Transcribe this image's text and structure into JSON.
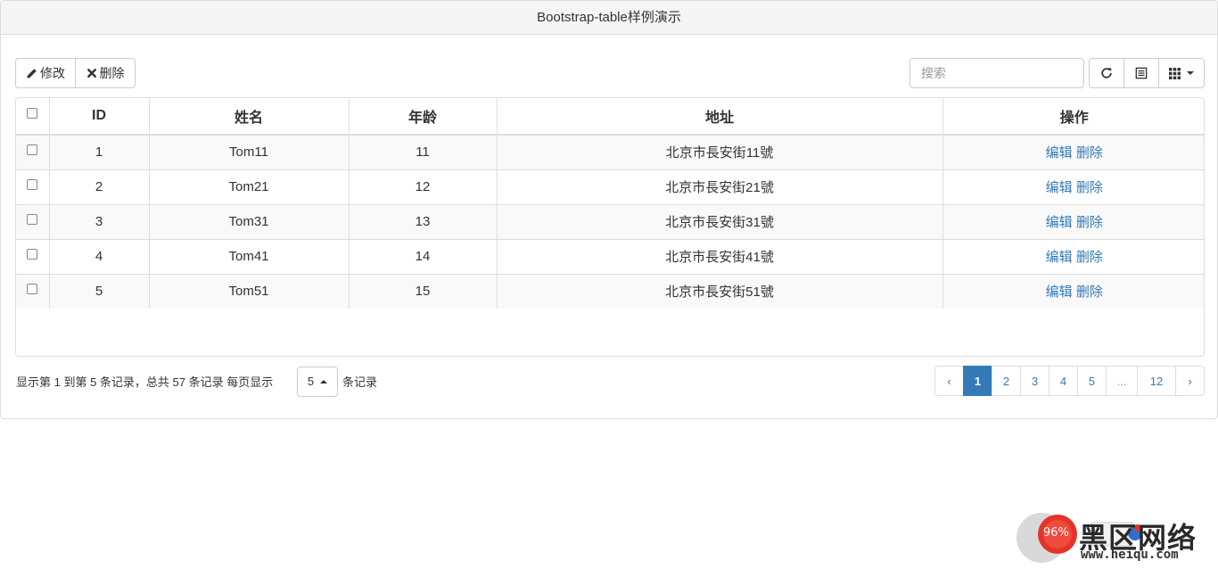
{
  "panel": {
    "title": "Bootstrap-table样例演示"
  },
  "toolbar": {
    "edit_label": "修改",
    "delete_label": "删除",
    "search_placeholder": "搜索"
  },
  "table": {
    "columns": [
      "ID",
      "姓名",
      "年龄",
      "地址",
      "操作"
    ],
    "rows": [
      {
        "id": "1",
        "name": "Tom11",
        "age": "11",
        "address": "北京市長安街11號"
      },
      {
        "id": "2",
        "name": "Tom21",
        "age": "12",
        "address": "北京市長安街21號"
      },
      {
        "id": "3",
        "name": "Tom31",
        "age": "13",
        "address": "北京市長安街31號"
      },
      {
        "id": "4",
        "name": "Tom41",
        "age": "14",
        "address": "北京市長安街41號"
      },
      {
        "id": "5",
        "name": "Tom51",
        "age": "15",
        "address": "北京市長安街51號"
      }
    ],
    "action_edit": "编辑",
    "action_delete": "删除"
  },
  "footer": {
    "info": "显示第 1 到第 5 条记录，总共 57 条记录 每页显示",
    "page_size": "5",
    "suffix": "条记录"
  },
  "pagination": {
    "prev": "‹",
    "pages": [
      "1",
      "2",
      "3",
      "4",
      "5",
      "...",
      "12"
    ],
    "active": "1",
    "next": "›"
  },
  "watermark": {
    "brand": "黑区网络",
    "url": "www.heiqu.com",
    "badge": "96%"
  },
  "colors": {
    "accent": "#337ab7",
    "border": "#dddddd",
    "stripe": "#f9f9f9"
  }
}
